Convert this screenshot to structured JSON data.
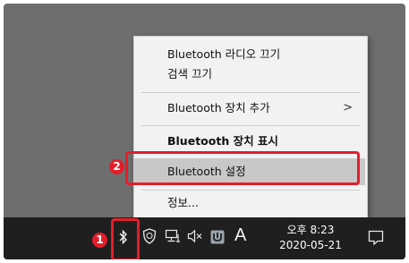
{
  "context_menu": {
    "items": [
      {
        "label": "Bluetooth 라디오 끄기"
      },
      {
        "label": "검색 끄기"
      },
      {
        "label": "Bluetooth 장치 추가",
        "submenu_arrow": ">"
      },
      {
        "label": "Bluetooth 장치 표시"
      },
      {
        "label": "Bluetooth 설정"
      },
      {
        "label": "정보..."
      }
    ]
  },
  "annotations": {
    "step1": "1",
    "step2": "2"
  },
  "taskbar": {
    "ime_indicator": "A",
    "clock": {
      "time": "오후 8:23",
      "date": "2020-05-21"
    },
    "icons": [
      "bluetooth-icon",
      "defender-icon",
      "network-icon",
      "volume-muted-icon",
      "app-icon",
      "notification-icon"
    ]
  },
  "colors": {
    "accent_red": "#e31e2b",
    "menu_bg": "#f2f2f2",
    "highlight": "#c8c8c8",
    "taskbar": "#1f1f1f"
  }
}
